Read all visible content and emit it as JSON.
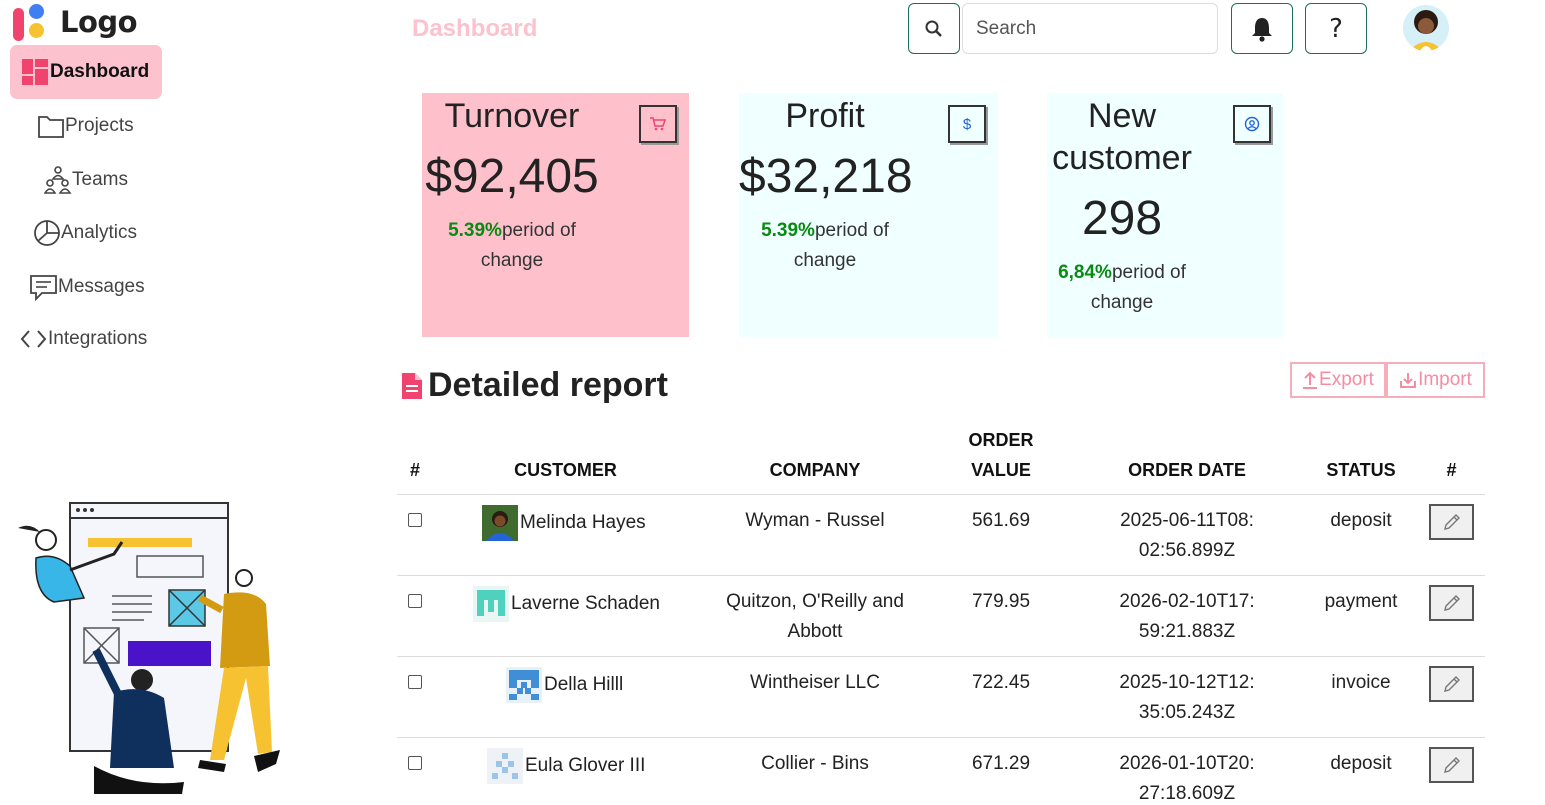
{
  "app": {
    "logo_text": "Logo",
    "page_title": "Dashboard"
  },
  "sidebar": {
    "items": [
      {
        "label": "Dashboard",
        "icon": "dashboard-icon",
        "active": true
      },
      {
        "label": "Projects",
        "icon": "folder-icon"
      },
      {
        "label": "Teams",
        "icon": "teams-icon"
      },
      {
        "label": "Analytics",
        "icon": "pie-chart-icon"
      },
      {
        "label": "Messages",
        "icon": "message-icon"
      },
      {
        "label": "Integrations",
        "icon": "code-icon"
      }
    ]
  },
  "header": {
    "search_placeholder": "Search",
    "help_label": "?"
  },
  "cards": [
    {
      "title": "Turnover",
      "value": "$92,405",
      "change_pct": "5.39%",
      "change_text": "period of change",
      "icon": "cart-icon"
    },
    {
      "title": "Profit",
      "value": "$32,218",
      "change_pct": "5.39%",
      "change_text": "period of change",
      "icon": "dollar-icon"
    },
    {
      "title": "New customer",
      "value": "298",
      "change_pct": "6,84%",
      "change_text": "period of change",
      "icon": "user-circle-icon"
    }
  ],
  "report": {
    "title": "Detailed report",
    "export_label": "Export",
    "import_label": "Import",
    "columns": [
      "#",
      "CUSTOMER",
      "COMPANY",
      "ORDER VALUE",
      "ORDER DATE",
      "STATUS",
      "#"
    ],
    "rows": [
      {
        "customer": "Melinda Hayes",
        "company": "Wyman - Russel",
        "order_value": "561.69",
        "order_date": "2025-06-11T08:02:56.899Z",
        "status": "deposit"
      },
      {
        "customer": "Laverne Schaden",
        "company": "Quitzon, O'Reilly and Abbott",
        "order_value": "779.95",
        "order_date": "2026-02-10T17:59:21.883Z",
        "status": "payment"
      },
      {
        "customer": "Della Hilll",
        "company": "Wintheiser LLC",
        "order_value": "722.45",
        "order_date": "2025-10-12T12:35:05.243Z",
        "status": "invoice"
      },
      {
        "customer": "Eula Glover III",
        "company": "Collier - Bins",
        "order_value": "671.29",
        "order_date": "2026-01-10T20:27:18.609Z",
        "status": "deposit"
      }
    ]
  },
  "colors": {
    "accent_pink": "#fcc2cd",
    "card_cyan": "#f0ffff",
    "positive_green": "#098a12",
    "border_teal": "#1d6e5d"
  }
}
